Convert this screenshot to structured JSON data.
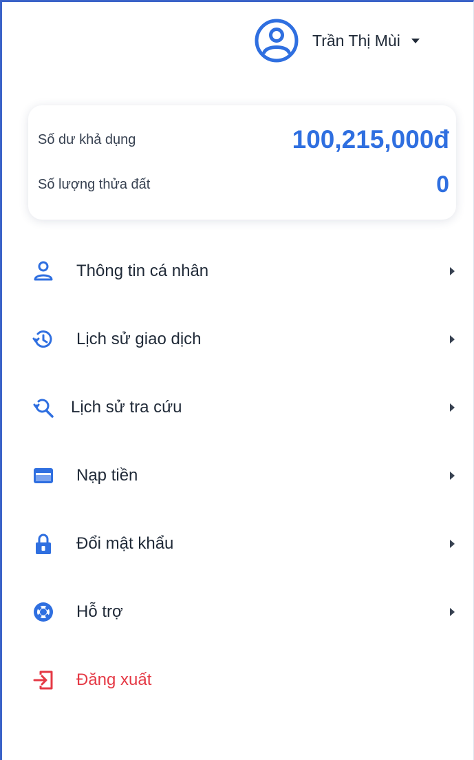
{
  "user": {
    "name": "Trần Thị Mùi",
    "avatar_icon": "user-circle-icon",
    "dropdown_icon": "caret-down-icon"
  },
  "summary": {
    "balance_label": "Số dư khả dụng",
    "balance_value": "100,215,000đ",
    "plots_label": "Số lượng thửa đất",
    "plots_value": "0"
  },
  "menu": {
    "items": [
      {
        "label": "Thông tin cá nhân",
        "icon": "user-icon"
      },
      {
        "label": "Lịch sử giao dịch",
        "icon": "history-icon"
      },
      {
        "label": "Lịch sử tra cứu",
        "icon": "search-history-icon"
      },
      {
        "label": "Nạp tiền",
        "icon": "credit-card-icon"
      },
      {
        "label": "Đổi mật khẩu",
        "icon": "lock-icon"
      },
      {
        "label": "Hỗ trợ",
        "icon": "lifebuoy-icon"
      }
    ],
    "logout": {
      "label": "Đăng xuất",
      "icon": "logout-icon"
    }
  },
  "colors": {
    "accent": "#2f6fe0",
    "text": "#1f2937",
    "danger": "#e53945",
    "frame_border": "#3b63c8"
  }
}
